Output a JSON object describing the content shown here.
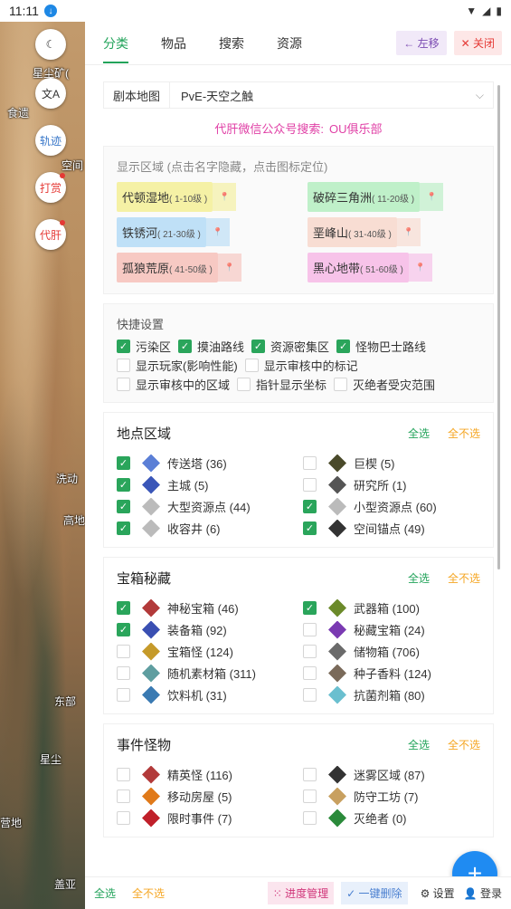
{
  "status": {
    "time": "11:11"
  },
  "map": {
    "labels": [
      "星尘矿(",
      "食遗",
      "空间",
      "洗动",
      "高地",
      "东部",
      "星尘",
      "营地",
      "盖亚"
    ],
    "buttons": {
      "track": "轨迹",
      "reward": "打赏",
      "proxy": "代肝"
    }
  },
  "tabs": [
    "分类",
    "物品",
    "搜索",
    "资源"
  ],
  "header": {
    "move_left": "左移",
    "close": "关闭"
  },
  "mapsel": {
    "label": "剧本地图",
    "value": "PvE-天空之触"
  },
  "promo": {
    "text": "代肝微信公众号搜索:",
    "name": "OU俱乐部"
  },
  "regions": {
    "hint": "显示区域 (点击名字隐藏，点击图标定位)",
    "list": [
      {
        "name": "代顿湿地",
        "level": "( 1-10级 )",
        "color": "#f5f1a5"
      },
      {
        "name": "破碎三角洲",
        "level": "( 11-20级 )",
        "color": "#bff0c9"
      },
      {
        "name": "铁锈河",
        "level": "( 21-30级 )",
        "color": "#bfe0f7"
      },
      {
        "name": "垩峰山",
        "level": "( 31-40级 )",
        "color": "#f8ddd3"
      },
      {
        "name": "孤狼荒原",
        "level": "( 41-50级 )",
        "color": "#f7c9c3"
      },
      {
        "name": "黑心地带",
        "level": "( 51-60级 )",
        "color": "#f7c3e9"
      }
    ]
  },
  "quick": {
    "title": "快捷设置",
    "items": [
      {
        "label": "污染区",
        "on": true
      },
      {
        "label": "摸油路线",
        "on": true
      },
      {
        "label": "资源密集区",
        "on": true
      },
      {
        "label": "怪物巴士路线",
        "on": true
      },
      {
        "label": "显示玩家(影响性能)",
        "on": false
      },
      {
        "label": "显示审核中的标记",
        "on": false
      },
      {
        "label": "显示审核中的区域",
        "on": false
      },
      {
        "label": "指针显示坐标",
        "on": false
      },
      {
        "label": "灭绝者受灾范围",
        "on": false
      }
    ]
  },
  "select_all": "全选",
  "select_none": "全不选",
  "sections": [
    {
      "title": "地点区域",
      "items": [
        {
          "label": "传送塔 (36)",
          "on": true,
          "icon": "tower-icon",
          "c": "#5b7fd6"
        },
        {
          "label": "巨楔 (5)",
          "on": false,
          "icon": "wedge-icon",
          "c": "#4a4a2a"
        },
        {
          "label": "主城 (5)",
          "on": true,
          "icon": "city-icon",
          "c": "#3a56b8"
        },
        {
          "label": "研究所 (1)",
          "on": false,
          "icon": "lab-icon",
          "c": "#555"
        },
        {
          "label": "大型资源点 (44)",
          "on": true,
          "icon": "resource-large-icon",
          "c": "#bbb"
        },
        {
          "label": "小型资源点 (60)",
          "on": true,
          "icon": "resource-small-icon",
          "c": "#bbb"
        },
        {
          "label": "收容井 (6)",
          "on": true,
          "icon": "well-icon",
          "c": "#bbb"
        },
        {
          "label": "空间锚点 (49)",
          "on": true,
          "icon": "anchor-icon",
          "c": "#333"
        }
      ]
    },
    {
      "title": "宝箱秘藏",
      "items": [
        {
          "label": "神秘宝箱 (46)",
          "on": true,
          "icon": "mystery-chest-icon",
          "c": "#b23a3a"
        },
        {
          "label": "武器箱 (100)",
          "on": true,
          "icon": "weapon-box-icon",
          "c": "#6b8a2a"
        },
        {
          "label": "装备箱 (92)",
          "on": true,
          "icon": "gear-box-icon",
          "c": "#3a4fb2"
        },
        {
          "label": "秘藏宝箱 (24)",
          "on": false,
          "icon": "hidden-chest-icon",
          "c": "#7a3ab2"
        },
        {
          "label": "宝箱怪 (124)",
          "on": false,
          "icon": "mimic-icon",
          "c": "#c59a2a"
        },
        {
          "label": "储物箱 (706)",
          "on": false,
          "icon": "storage-box-icon",
          "c": "#6b6b6b"
        },
        {
          "label": "随机素材箱 (311)",
          "on": false,
          "icon": "material-box-icon",
          "c": "#5f9ea0"
        },
        {
          "label": "种子香料 (124)",
          "on": false,
          "icon": "seed-icon",
          "c": "#7a6a5a"
        },
        {
          "label": "饮料机 (31)",
          "on": false,
          "icon": "drink-machine-icon",
          "c": "#3a7ab2"
        },
        {
          "label": "抗菌剂箱 (80)",
          "on": false,
          "icon": "antibiotic-box-icon",
          "c": "#6abfcf"
        }
      ]
    },
    {
      "title": "事件怪物",
      "items": [
        {
          "label": "精英怪 (116)",
          "on": false,
          "icon": "elite-icon",
          "c": "#b23a3a"
        },
        {
          "label": "迷雾区域 (87)",
          "on": false,
          "icon": "fog-icon",
          "c": "#333"
        },
        {
          "label": "移动房屋 (5)",
          "on": false,
          "icon": "mobile-house-icon",
          "c": "#e07a1a"
        },
        {
          "label": "防守工坊 (7)",
          "on": false,
          "icon": "workshop-icon",
          "c": "#c8a060"
        },
        {
          "label": "限时事件 (7)",
          "on": false,
          "icon": "timed-event-icon",
          "c": "#c0202a"
        },
        {
          "label": "灭绝者 (0)",
          "on": false,
          "icon": "exterminator-icon",
          "c": "#2a8a3a"
        }
      ]
    }
  ],
  "bottom": {
    "all": "全选",
    "none": "全不选",
    "progress": "进度管理",
    "delete": "一键删除",
    "settings": "设置",
    "login": "登录"
  }
}
